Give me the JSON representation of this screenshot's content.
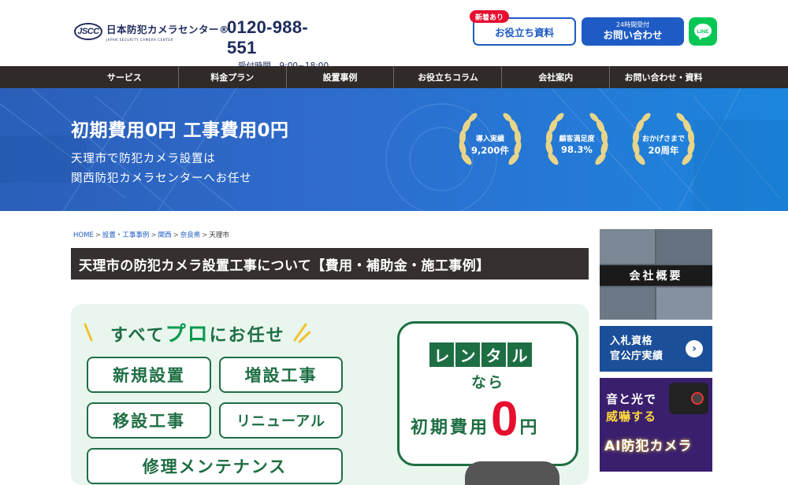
{
  "header": {
    "logo_mark": "JSCC",
    "logo_name": "日本防犯カメラセンター®",
    "logo_en": "JAPAN SECURITY CAMERA CENTER",
    "phone": "0120-988-551",
    "hours": "受付時間　9:00~18:00",
    "docs_badge": "新着あり",
    "docs_button": "お役立ち資料",
    "contact_small": "24時間受付",
    "contact_button": "お問い合わせ",
    "line_label": "LINE"
  },
  "nav": {
    "items": [
      "サービス",
      "料金プラン",
      "設置事例",
      "お役立ちコラム",
      "会社案内",
      "お問い合わせ・資料"
    ]
  },
  "hero": {
    "title": "初期費用0円 工事費用0円",
    "subtitle_1": "天理市で防犯カメラ設置は",
    "subtitle_2": "関西防犯カメラセンターへお任せ",
    "awards": [
      {
        "label": "導入実績",
        "value": "9,200件"
      },
      {
        "label": "顧客満足度",
        "value": "98.3%"
      },
      {
        "label": "おかげさまで",
        "value": "20周年"
      }
    ]
  },
  "breadcrumb": {
    "home": "HOME",
    "cat": "設置・工事事例",
    "region": "関西",
    "pref": "奈良県",
    "current": "天理市",
    "sep": ">"
  },
  "page_title": "天理市の防犯カメラ設置工事について【費用・補助金・施工事例】",
  "banner": {
    "head_pre": "すべて",
    "head_pro": "プロ",
    "head_post": "にお任せ",
    "tags": [
      "新規設置",
      "増設工事",
      "移設工事",
      "リニューアル",
      "修理メンテナンス"
    ],
    "rental_letters": [
      "レ",
      "ン",
      "タ",
      "ル"
    ],
    "rental_nara": "なら",
    "rental_text": "初期費用",
    "rental_zero": "0",
    "rental_yen": "円"
  },
  "sidebar": {
    "company": "会社概要",
    "tender_1": "入札資格",
    "tender_2": "官公庁実績",
    "tender_arrow": "›",
    "ai_1": "音と光で",
    "ai_2": "威嚇する",
    "ai_3": "AI防犯カメラ"
  },
  "colors": {
    "navy": "#1e2b5e",
    "blue": "#1f5bc4",
    "red": "#e60d2e",
    "green": "#1e6e43",
    "line_green": "#06c755",
    "nav_bg": "#302a28"
  }
}
